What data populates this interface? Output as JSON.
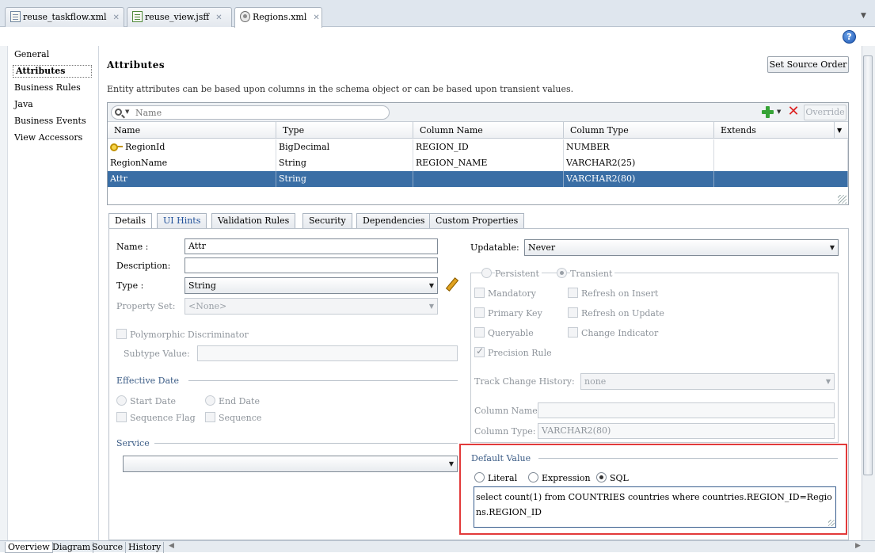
{
  "file_tabs": [
    {
      "label": "reuse_taskflow.xml",
      "active": false
    },
    {
      "label": "reuse_view.jsff",
      "active": false
    },
    {
      "label": "Regions.xml",
      "active": true
    }
  ],
  "help_label": "?",
  "left_nav": [
    "General",
    "Attributes",
    "Business Rules",
    "Java",
    "Business Events",
    "View Accessors"
  ],
  "header": {
    "title": "Attributes",
    "set_source_order": "Set Source Order",
    "description": "Entity attributes can be based upon columns in the schema object or can be based upon transient values."
  },
  "table": {
    "search_placeholder": "Name",
    "override_label": "Override",
    "columns": [
      "Name",
      "Type",
      "Column Name",
      "Column Type",
      "Extends"
    ],
    "rows": [
      {
        "name": "RegionId",
        "type": "BigDecimal",
        "column_name": "REGION_ID",
        "column_type": "NUMBER",
        "extends": "",
        "key": true
      },
      {
        "name": "RegionName",
        "type": "String",
        "column_name": "REGION_NAME",
        "column_type": "VARCHAR2(25)",
        "extends": ""
      },
      {
        "name": "Attr",
        "type": "String",
        "column_name": "",
        "column_type": "VARCHAR2(80)",
        "extends": "",
        "selected": true
      }
    ]
  },
  "detail_tabs": [
    "Details",
    "UI Hints",
    "Validation Rules",
    "Security",
    "Dependencies",
    "Custom Properties"
  ],
  "details": {
    "name_label": "Name :",
    "name_value": "Attr",
    "description_label": "Description:",
    "description_value": "",
    "type_label": "Type :",
    "type_value": "String",
    "property_set_label": "Property Set:",
    "property_set_value": "<None>",
    "polymorphic_label": "Polymorphic Discriminator",
    "subtype_label": "Subtype Value:",
    "effective_date_title": "Effective Date",
    "start_date": "Start Date",
    "end_date": "End Date",
    "sequence_flag": "Sequence Flag",
    "sequence": "Sequence",
    "service_title": "Service",
    "updatable_label": "Updatable:",
    "updatable_value": "Never",
    "persistent": "Persistent",
    "transient": "Transient",
    "mandatory": "Mandatory",
    "refresh_insert": "Refresh on Insert",
    "primary_key": "Primary Key",
    "refresh_update": "Refresh on Update",
    "queryable": "Queryable",
    "change_indicator": "Change Indicator",
    "precision_rule": "Precision Rule",
    "track_change_label": "Track Change History:",
    "track_change_value": "none",
    "column_name_label": "Column Name:",
    "column_name_value": "",
    "column_type_label": "Column Type:",
    "column_type_value": "VARCHAR2(80)",
    "default_value_title": "Default Value",
    "literal": "Literal",
    "expression": "Expression",
    "sql": "SQL",
    "sql_text": "select count(1) from COUNTRIES countries where countries.REGION_ID=Regions.REGION_ID"
  },
  "bottom_tabs": [
    "Overview",
    "Diagram",
    "Source",
    "History"
  ]
}
